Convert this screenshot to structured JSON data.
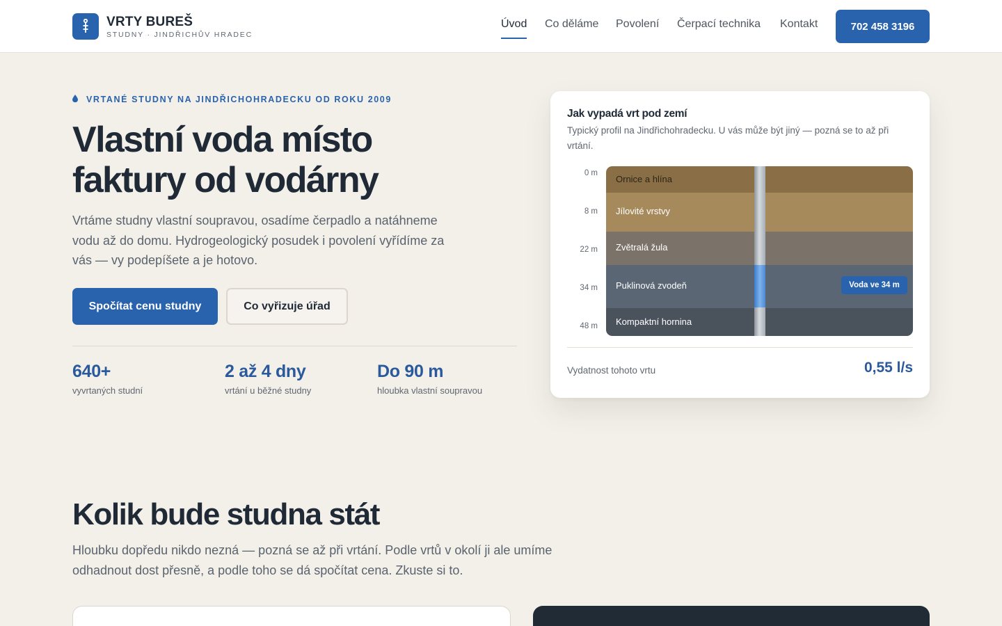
{
  "header": {
    "brand_name": "VRTY BUREŠ",
    "brand_sub": "STUDNY · JINDŘICHŮV HRADEC",
    "nav": [
      "Úvod",
      "Co děláme",
      "Povolení",
      "Čerpací technika",
      "Kontakt"
    ],
    "active_nav": "Úvod",
    "phone": "702 458 3196"
  },
  "hero": {
    "eyebrow": "VRTANÉ STUDNY NA JINDŘICHOHRADECKU OD ROKU 2009",
    "title_line1": "Vlastní voda místo",
    "title_line2": "faktury od vodárny",
    "lead": "Vrtáme studny vlastní soupravou, osadíme čerpadlo a natáhneme vodu až do domu. Hydrogeologický posudek i povolení vyřídíme za vás — vy podepíšete a je hotovo.",
    "primary_button": "Spočítat cenu studny",
    "secondary_button": "Co vyřizuje úřad",
    "stats": [
      {
        "value": "640+",
        "label": "vyvrtaných studní"
      },
      {
        "value": "2 až 4 dny",
        "label": "vrtání u běžné studny"
      },
      {
        "value": "Do 90 m",
        "label": "hloubka vlastní soupravou"
      }
    ]
  },
  "profile_card": {
    "title": "Jak vypadá vrt pod zemí",
    "subtitle": "Typický profil na Jindřichohradecku. U vás může být jiný — pozná se to až při vrtání.",
    "depths": [
      "0 m",
      "8 m",
      "22 m",
      "34 m",
      "48 m"
    ],
    "layers": [
      {
        "name": "Ornice a hlína",
        "color": "#8a6e45",
        "text_color": "#2b2418"
      },
      {
        "name": "Jílovité vrstvy",
        "color": "#a68a5c",
        "text_color": "#ffffff"
      },
      {
        "name": "Zvětralá žula",
        "color": "#7b736a",
        "text_color": "#ffffff"
      },
      {
        "name": "Puklinová zvodeň",
        "color": "#5a6674",
        "text_color": "#ffffff"
      },
      {
        "name": "Kompaktní hornina",
        "color": "#4a525c",
        "text_color": "#ffffff"
      }
    ],
    "water_badge": "Voda ve 34 m",
    "yield_label": "Vydatnost tohoto vrtu",
    "yield_value": "0,55 l/s"
  },
  "pricing": {
    "title": "Kolik bude studna stát",
    "lead": "Hloubku dopředu nikdo nezná — pozná se až při vrtání. Podle vrtů v okolí ji ale umíme odhadnout dost přesně, a podle toho se dá spočítat cena. Zkuste si to."
  },
  "colors": {
    "accent": "#2a63ad",
    "background": "#f3f0ea",
    "dark_panel": "#212b36"
  }
}
